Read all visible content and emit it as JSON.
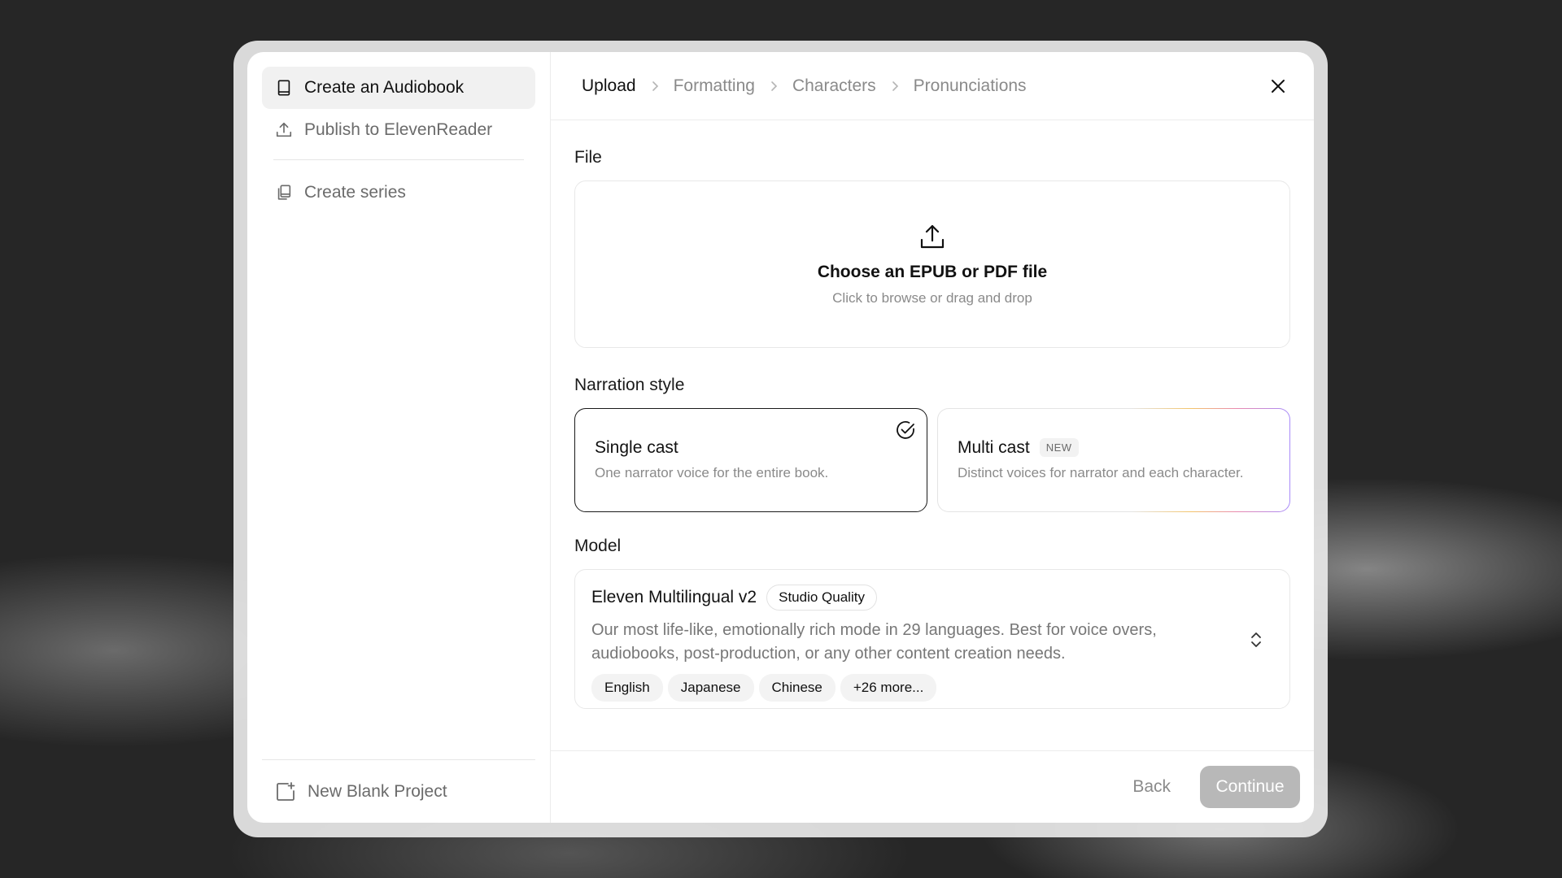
{
  "sidebar": {
    "items": [
      {
        "label": "Create an Audiobook",
        "icon": "book-icon"
      },
      {
        "label": "Publish to ElevenReader",
        "icon": "upload-icon"
      },
      {
        "label": "Create series",
        "icon": "series-icon"
      }
    ],
    "bottom": {
      "label": "New Blank Project",
      "icon": "new-project-icon"
    }
  },
  "breadcrumb": {
    "steps": [
      "Upload",
      "Formatting",
      "Characters",
      "Pronunciations"
    ],
    "active": "Upload"
  },
  "file": {
    "label": "File",
    "title": "Choose an EPUB or PDF file",
    "subtitle": "Click to browse or drag and drop"
  },
  "narration": {
    "label": "Narration style",
    "single": {
      "title": "Single cast",
      "desc": "One narrator voice for the entire book.",
      "selected": true
    },
    "multi": {
      "title": "Multi cast",
      "badge": "NEW",
      "desc": "Distinct voices for narrator and each character."
    }
  },
  "model": {
    "label": "Model",
    "name": "Eleven Multilingual v2",
    "badge": "Studio Quality",
    "desc": "Our most life-like, emotionally rich mode in 29 languages. Best for voice overs, audiobooks, post-production, or any other content creation needs.",
    "languages": [
      "English",
      "Japanese",
      "Chinese",
      "+26 more..."
    ]
  },
  "footer": {
    "back": "Back",
    "continue": "Continue"
  },
  "colors": {
    "accent": "#111111",
    "disabled_button": "#b8b8b8",
    "muted_text": "#8a8a8a"
  }
}
